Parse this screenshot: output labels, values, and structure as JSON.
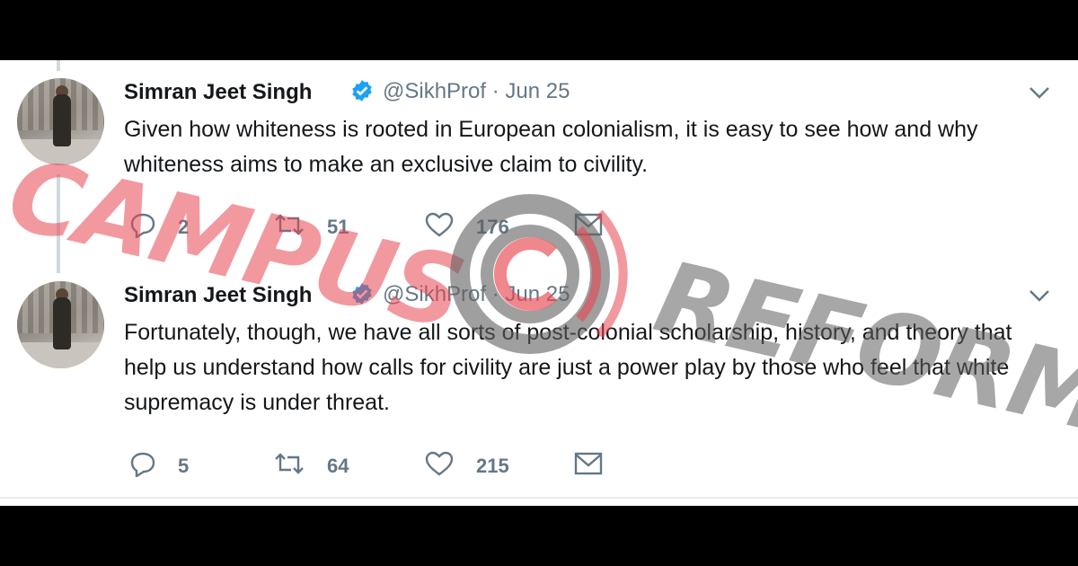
{
  "tweets": [
    {
      "author": "Simran Jeet Singh",
      "handle": "@SikhProf · Jun 25",
      "text": "Given how whiteness is rooted in European colonialism, it is easy to see how and why whiteness aims to make an exclusive claim to civility.",
      "replies": "2",
      "retweets": "51",
      "likes": "176"
    },
    {
      "author": "Simran Jeet Singh",
      "handle": "@SikhProf · Jun 25",
      "text": "Fortunately, though, we have all sorts of post-colonial scholarship, history, and theory that help us understand how calls for civility are just a power play by those who feel that white supremacy is under threat.",
      "replies": "5",
      "retweets": "64",
      "likes": "215"
    }
  ],
  "watermark": {
    "left_text": "CAMPUS",
    "right_text": "REFORM",
    "left_color": "#e84650",
    "right_color": "#5f5f5f"
  },
  "colors": {
    "verified": "#1da1f2",
    "secondary_text": "#657786",
    "primary_text": "#14171a"
  },
  "icons": {
    "reply": "reply-icon",
    "retweet": "retweet-icon",
    "like": "heart-icon",
    "message": "envelope-icon",
    "verified": "verified-badge-icon",
    "menu": "chevron-down-icon"
  }
}
